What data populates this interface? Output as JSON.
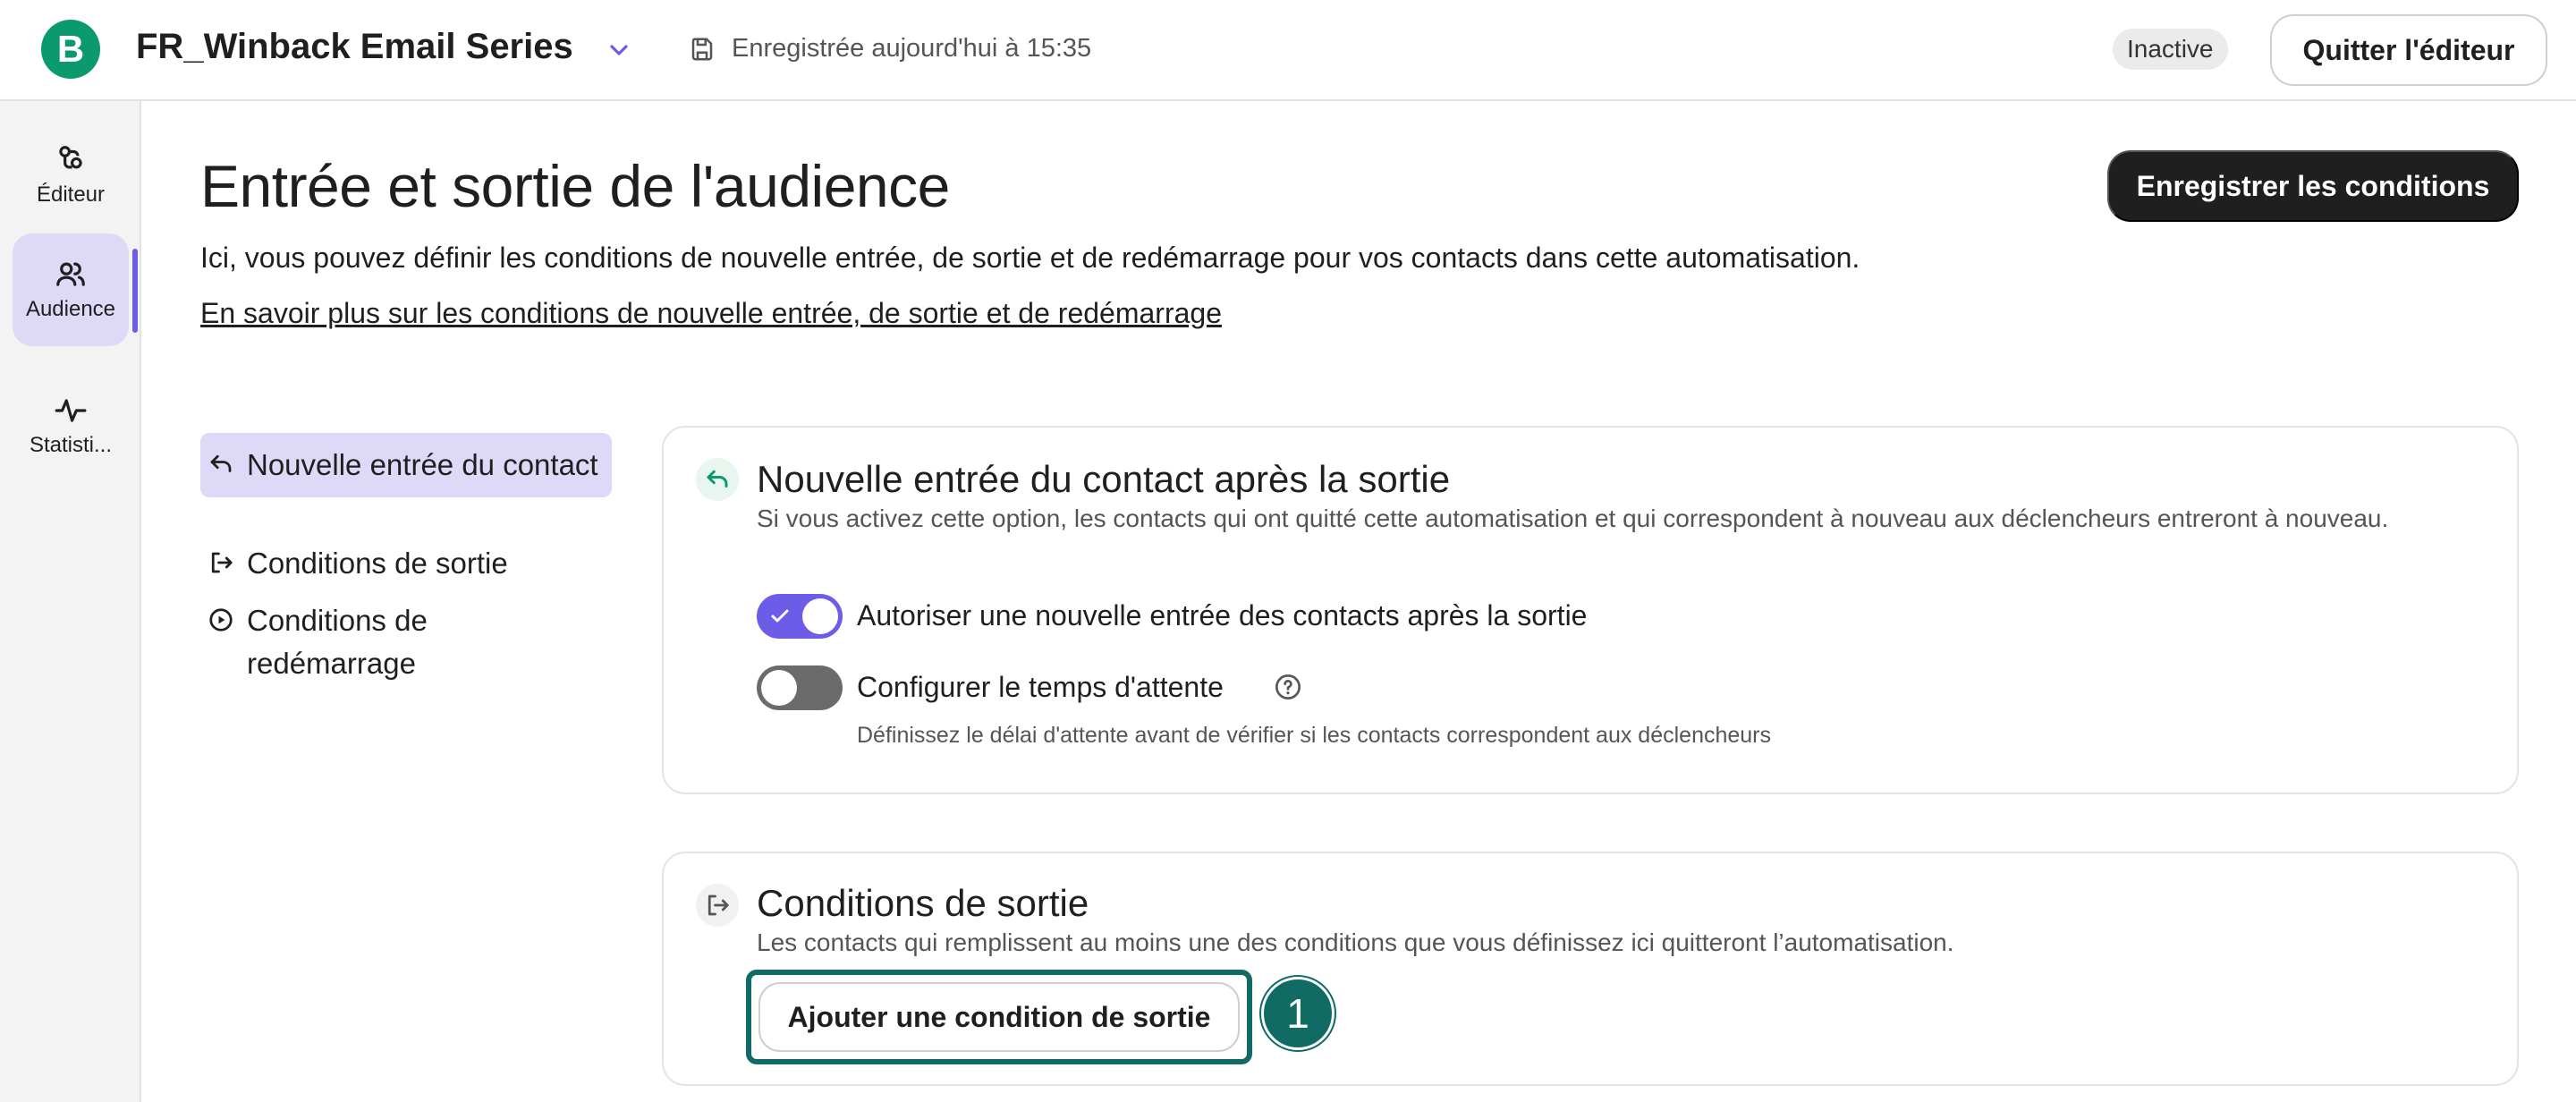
{
  "header": {
    "logo_letter": "B",
    "title": "FR_Winback Email Series",
    "saved_status": "Enregistrée aujourd'hui à 15:35",
    "status_badge": "Inactive",
    "quit_label": "Quitter l'éditeur"
  },
  "rail": {
    "items": [
      {
        "label": "Éditeur",
        "icon": "workflow-icon",
        "active": false
      },
      {
        "label": "Audience",
        "icon": "users-icon",
        "active": true
      },
      {
        "label": "Statisti...",
        "icon": "activity-icon",
        "active": false
      }
    ]
  },
  "page": {
    "title": "Entrée et sortie de l'audience",
    "save_button": "Enregistrer les conditions",
    "description": "Ici, vous pouvez définir les conditions de nouvelle entrée, de sortie et de redémarrage pour vos contacts dans cette automatisation.",
    "learn_more": "En savoir plus sur les conditions de nouvelle entrée, de sortie et de redémarrage"
  },
  "section_nav": [
    {
      "label": "Nouvelle entrée du contact",
      "icon": "reentry-icon",
      "active": true
    },
    {
      "label": "Conditions de sortie",
      "icon": "exit-icon",
      "active": false
    },
    {
      "label": "Conditions de redémarrage",
      "icon": "restart-icon",
      "active": false
    }
  ],
  "reentry_card": {
    "title": "Nouvelle entrée du contact après la sortie",
    "description": "Si vous activez cette option, les contacts qui ont quitté cette automatisation et qui correspondent à nouveau aux déclencheurs entreront à nouveau.",
    "toggle_allow": {
      "label": "Autoriser une nouvelle entrée des contacts après la sortie",
      "on": true
    },
    "toggle_wait": {
      "label": "Configurer le temps d'attente",
      "on": false
    },
    "wait_hint": "Définissez le délai d'attente avant de vérifier si les contacts correspondent aux déclencheurs"
  },
  "exit_card": {
    "title": "Conditions de sortie",
    "description": "Les contacts qui remplissent au moins une des conditions que vous définissez ici quitteront l’automatisation.",
    "add_button": "Ajouter une condition de sortie",
    "step_badge": "1"
  },
  "colors": {
    "accent": "#6c5ce7",
    "accent_soft": "#ddd9f6",
    "brand": "#0b996e",
    "highlight": "#0f6b63"
  }
}
